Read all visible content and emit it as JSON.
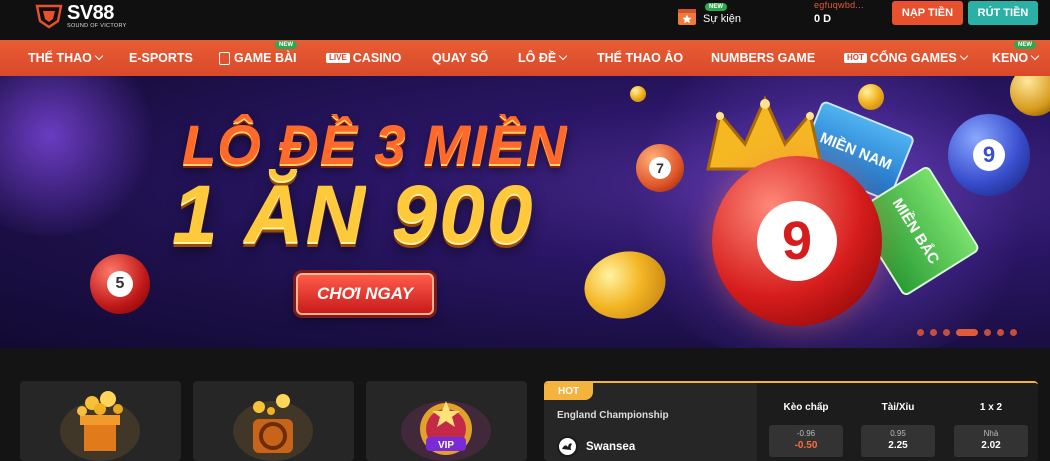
{
  "header": {
    "brand": {
      "name": "SV88",
      "tagline": "SOUND OF VICTORY"
    },
    "event": {
      "label": "Sự kiện",
      "badge": "NEW",
      "icon": "calendar-star-icon"
    },
    "account": {
      "username": "egfuqwbd...",
      "balance": "0 D"
    },
    "buttons": {
      "deposit": "NẠP TIỀN",
      "withdraw": "RÚT TIỀN"
    },
    "colors": {
      "deposit": "#e8512d",
      "withdraw": "#2bb0a6"
    }
  },
  "nav": {
    "items": [
      {
        "label": "THỂ THAO",
        "dropdown": true
      },
      {
        "label": "E-SPORTS"
      },
      {
        "label": "GAME BÀI",
        "badge": "NEW",
        "icon": "cards-icon"
      },
      {
        "label": "CASINO",
        "tag": "LIVE"
      },
      {
        "label": "QUAY SỐ"
      },
      {
        "label": "LÔ ĐỀ",
        "dropdown": true
      },
      {
        "label": "THỂ THAO ẢO"
      },
      {
        "label": "NUMBERS GAME"
      },
      {
        "label": "CỔNG GAMES",
        "tag": "HOT",
        "dropdown": true
      },
      {
        "label": "KENO",
        "badge": "NEW",
        "dropdown": true
      }
    ],
    "color": "#e25530"
  },
  "banner": {
    "headline": "LÔ ĐỀ 3 MIỀN",
    "subheadline": "1 ĂN 900",
    "cta": "CHƠI NGAY",
    "card_1": "MIỀN NAM",
    "card_2": "MIỀN BẮC",
    "ball_main": "9",
    "ball_left": "5",
    "ball_small": "7",
    "ball_right": "9",
    "slides": 7,
    "active_slide": 4
  },
  "hot_match": {
    "tag": "HOT",
    "league": "England Championship",
    "team": "Swansea",
    "columns": [
      "Kèo chấp",
      "Tài/Xỉu",
      "1 x 2"
    ],
    "odds": [
      {
        "top": "-0.96",
        "value": "-0.50",
        "value_color": "#ff6a3d"
      },
      {
        "top": "0.95",
        "value": "2.25",
        "value_color": "#ffffff"
      },
      {
        "top": "Nhà",
        "value": "2.02",
        "value_color": "#ffffff"
      }
    ]
  }
}
